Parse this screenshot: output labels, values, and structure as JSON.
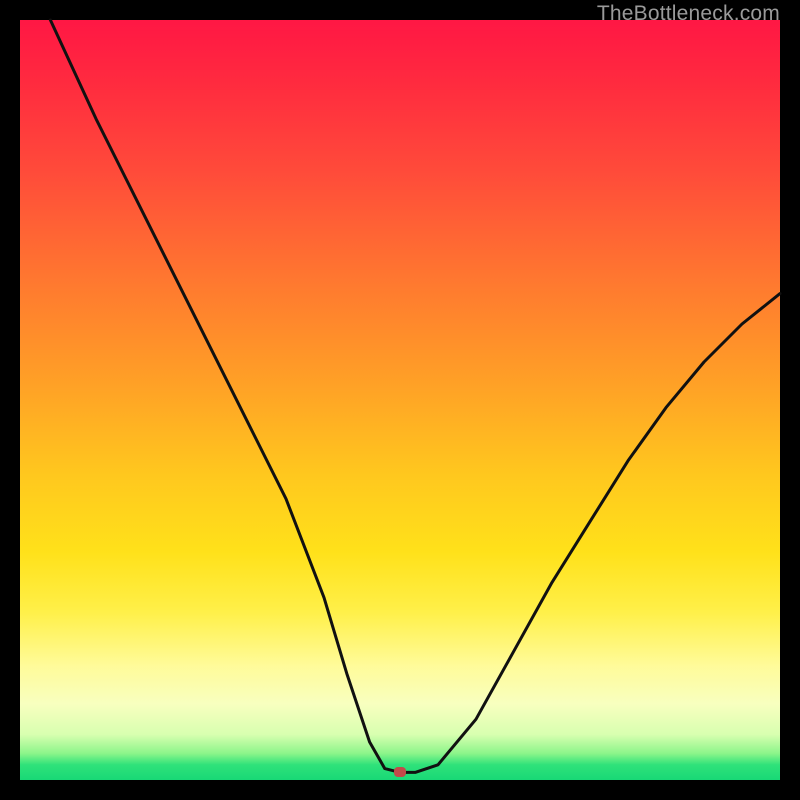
{
  "watermark": "TheBottleneck.com",
  "chart_data": {
    "type": "line",
    "title": "",
    "xlabel": "",
    "ylabel": "",
    "xlim": [
      0,
      100
    ],
    "ylim": [
      0,
      100
    ],
    "grid": false,
    "legend": false,
    "series": [
      {
        "name": "bottleneck-curve",
        "x": [
          4,
          10,
          15,
          20,
          25,
          30,
          35,
          40,
          43,
          46,
          48,
          50,
          52,
          55,
          60,
          65,
          70,
          75,
          80,
          85,
          90,
          95,
          100
        ],
        "y": [
          100,
          87,
          77,
          67,
          57,
          47,
          37,
          24,
          14,
          5,
          1.5,
          1,
          1,
          2,
          8,
          17,
          26,
          34,
          42,
          49,
          55,
          60,
          64
        ]
      }
    ],
    "marker": {
      "name": "current-point",
      "x": 50,
      "y": 1,
      "color": "#c24a4a"
    },
    "background_gradient": {
      "top": "#ff1744",
      "upper_mid": "#ffa126",
      "mid": "#ffe11a",
      "lower_mid": "#fffb9a",
      "bottom": "#18d876"
    }
  }
}
